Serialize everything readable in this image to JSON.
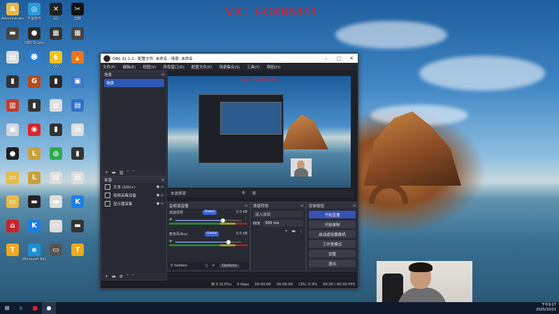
{
  "watermark": "VX：FG666444",
  "desktop_icons": [
    {
      "label": "Administrator",
      "color": "#e7b84a",
      "glyph": "A"
    },
    {
      "label": "不良软件",
      "color": "#2a9ad8",
      "glyph": "◎"
    },
    {
      "label": "GG",
      "color": "#222222",
      "glyph": "✕"
    },
    {
      "label": "剪映",
      "color": "#111111",
      "glyph": "✂"
    },
    {
      "label": "",
      "color": "#444444",
      "glyph": "▬"
    },
    {
      "label": "OBS Studio",
      "color": "#2b2b2b",
      "glyph": "●"
    },
    {
      "label": "",
      "color": "#333333",
      "glyph": "▦"
    },
    {
      "label": "",
      "color": "#444444",
      "glyph": "▦"
    },
    {
      "label": "",
      "color": "#dddddd",
      "glyph": "▤"
    },
    {
      "label": "",
      "color": "#2a7fd6",
      "glyph": "☻"
    },
    {
      "label": "QQ",
      "color": "#f3c21d",
      "glyph": "♞"
    },
    {
      "label": "",
      "color": "#e8752a",
      "glyph": "🔥"
    },
    {
      "label": "",
      "color": "#333333",
      "glyph": "▮"
    },
    {
      "label": "",
      "color": "#b34b1c",
      "glyph": "G"
    },
    {
      "label": "",
      "color": "#2a2a2a",
      "glyph": "▮"
    },
    {
      "label": "",
      "color": "#3d78c9",
      "glyph": "▣"
    },
    {
      "label": "",
      "color": "#c33c2c",
      "glyph": "▥"
    },
    {
      "label": "",
      "color": "#333333",
      "glyph": "▮"
    },
    {
      "label": "",
      "color": "#dddddd",
      "glyph": "▤"
    },
    {
      "label": "",
      "color": "#2a72c9",
      "glyph": "▤"
    },
    {
      "label": "",
      "color": "#cfd6e0",
      "glyph": "▣"
    },
    {
      "label": "",
      "color": "#d8262e",
      "glyph": "◉"
    },
    {
      "label": "",
      "color": "#333333",
      "glyph": "▮"
    },
    {
      "label": "",
      "color": "#dddddd",
      "glyph": "▤"
    },
    {
      "label": "",
      "color": "#1e1e1e",
      "glyph": "●"
    },
    {
      "label": "",
      "color": "#c8a03d",
      "glyph": "L"
    },
    {
      "label": "",
      "color": "#2fa84f",
      "glyph": "◍"
    },
    {
      "label": "",
      "color": "#333333",
      "glyph": "▮"
    },
    {
      "label": "",
      "color": "#e8bc46",
      "glyph": "▭"
    },
    {
      "label": "",
      "color": "#c8a03d",
      "glyph": "L"
    },
    {
      "label": "",
      "color": "#dddddd",
      "glyph": "▤"
    },
    {
      "label": "",
      "color": "#dddddd",
      "glyph": "▤"
    },
    {
      "label": "",
      "color": "#e8bc46",
      "glyph": "▭"
    },
    {
      "label": "",
      "color": "#222222",
      "glyph": "▬"
    },
    {
      "label": "",
      "color": "#dddddd",
      "glyph": "▬"
    },
    {
      "label": "",
      "color": "#1d7ee8",
      "glyph": "K"
    },
    {
      "label": "",
      "color": "#c9232a",
      "glyph": "⌂"
    },
    {
      "label": "",
      "color": "#1d7ee8",
      "glyph": "K"
    },
    {
      "label": "",
      "color": "#dddddd",
      "glyph": "▭"
    },
    {
      "label": "",
      "color": "#333333",
      "glyph": "▬"
    },
    {
      "label": "",
      "color": "#f1a81c",
      "glyph": "T"
    },
    {
      "label": "Microsoft Edge",
      "color": "#1e8fd6",
      "glyph": "e"
    },
    {
      "label": "",
      "color": "#555555",
      "glyph": "▭"
    },
    {
      "label": "",
      "color": "#f1a81c",
      "glyph": "T"
    }
  ],
  "obs": {
    "title": "OBS 31.1.2 - 配置文件: 未命名 - 场景: 未命名",
    "menu": [
      "文件(F)",
      "编辑(E)",
      "视图(V)",
      "停靠窗口(D)",
      "配置文件(P)",
      "场景集合(S)",
      "工具(T)",
      "帮助(H)"
    ],
    "scenes_title": "场景",
    "scenes": [
      "场景"
    ],
    "sources_title": "来源",
    "sources": [
      "文本 (GDI+)",
      "视频采集设备",
      "显示器采集"
    ],
    "preview_watermark": "VX：FG666444",
    "scene_bar_label": "未选择源",
    "mixer_title": "音频混音器",
    "mixer_channels": [
      {
        "name": "桌面音频",
        "db": "0.0 dB",
        "level": 0.72
      },
      {
        "name": "麦克风/Aux",
        "db": "0.0 dB",
        "level": 0.8
      }
    ],
    "mixer_badge": "Global",
    "transition_title": "场景转场",
    "transition_value": "淡入淡出",
    "duration_label": "时长",
    "duration_value": "300 ms",
    "controls_title": "控制按钮",
    "controls": [
      "开始直播",
      "开始录制",
      "启动虚拟摄像机",
      "工作室模式",
      "设置",
      "退出"
    ],
    "hidden_label": "0 hidden",
    "options_label": "Options",
    "status": [
      "帧 0 (0.0%)",
      "0 kbps",
      "00:00:00",
      "00:00:00",
      "CPU: 0.9%",
      "60.00 / 60.00 FPS"
    ]
  },
  "taskbar": {
    "time": "下午9:27",
    "date": "2025/10/21"
  }
}
